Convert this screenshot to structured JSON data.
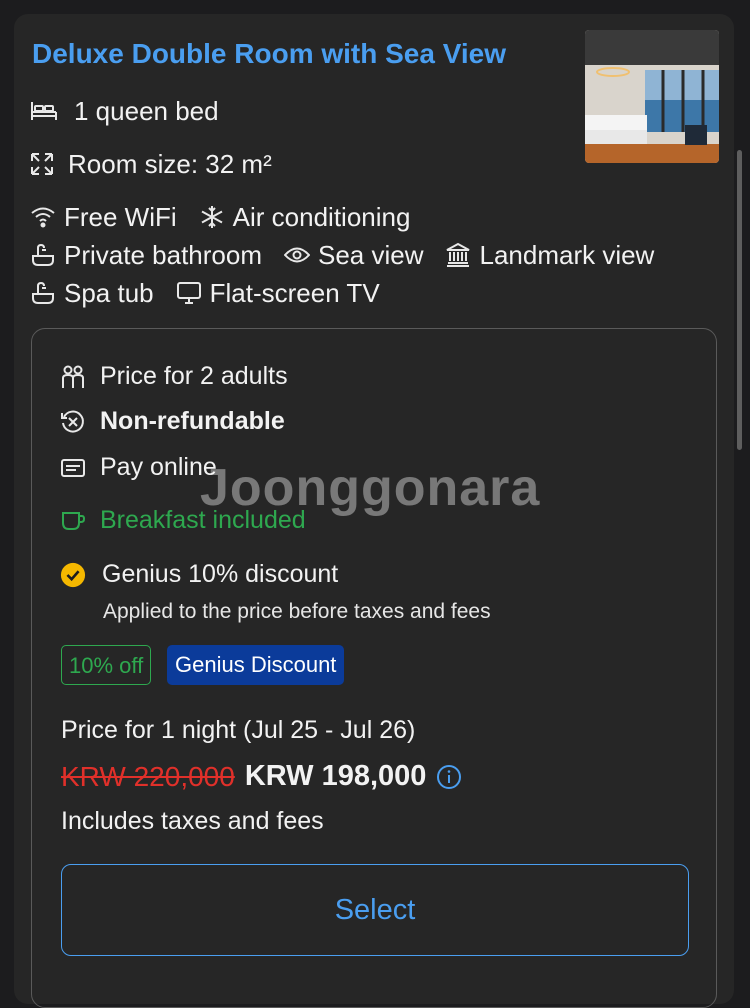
{
  "room": {
    "title": "Deluxe Double Room with Sea View",
    "bed": "1 queen bed",
    "size": "Room size: 32 m²"
  },
  "facilities": {
    "row1": [
      {
        "icon": "wifi-icon",
        "label": "Free WiFi"
      },
      {
        "icon": "snowflake-icon",
        "label": "Air conditioning"
      }
    ],
    "row2": [
      {
        "icon": "bath-icon",
        "label": "Private bathroom"
      },
      {
        "icon": "eye-icon",
        "label": "Sea view"
      },
      {
        "icon": "landmark-icon",
        "label": "Landmark view"
      }
    ],
    "row3": [
      {
        "icon": "tub-icon",
        "label": "Spa tub"
      },
      {
        "icon": "tv-icon",
        "label": "Flat-screen TV"
      }
    ]
  },
  "conditions": {
    "guests": "Price for 2 adults",
    "refund": "Non-refundable",
    "payment": "Pay online",
    "breakfast": "Breakfast included",
    "genius": "Genius 10% discount",
    "genius_note": "Applied to the price before taxes and fees"
  },
  "badges": {
    "off": "10% off",
    "genius": "Genius Discount"
  },
  "price": {
    "label": "Price for 1 night (Jul 25 - Jul 26)",
    "original": "KRW 220,000",
    "current": "KRW 198,000",
    "note": "Includes taxes and fees"
  },
  "actions": {
    "select": "Select"
  },
  "watermark": "Joonggonara",
  "colors": {
    "link": "#4a9ef0",
    "green": "#2ea84f",
    "strike": "#e0302a",
    "genius": "#0b3b9a",
    "check": "#f5b800"
  }
}
